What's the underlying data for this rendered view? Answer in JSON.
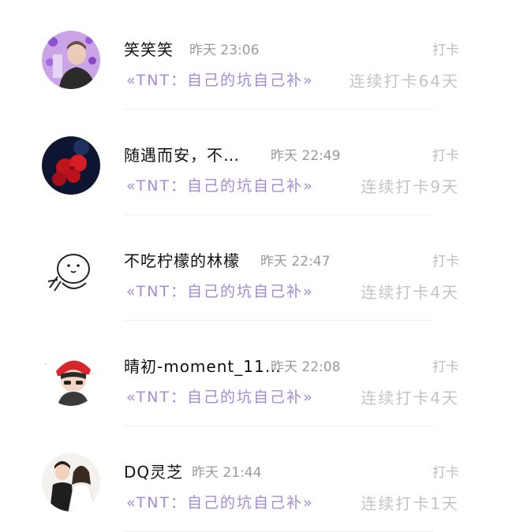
{
  "colors": {
    "group_link": "#a58ad6",
    "time": "#9a9a9a",
    "action": "#bdbdbd",
    "streak": "#c4c4c4"
  },
  "records": [
    {
      "avatar": "avatar-purple-hearts-photo",
      "name": "笑笑笑",
      "time": "昨天 23:06",
      "action": "打卡",
      "group": "«TNT：自己的坑自己补»",
      "streak": "连续打卡64天"
    },
    {
      "avatar": "avatar-red-roses-photo",
      "name": "随遇而安，不…",
      "time": "昨天 22:49",
      "action": "打卡",
      "group": "«TNT：自己的坑自己补»",
      "streak": "连续打卡9天"
    },
    {
      "avatar": "avatar-cartoon-doodle",
      "name": "不吃柠檬的林檬",
      "time": "昨天 22:47",
      "action": "打卡",
      "group": "«TNT：自己的坑自己补»",
      "streak": "连续打卡4天"
    },
    {
      "avatar": "avatar-anime-boy-red-cap",
      "name": "晴初-moment_11…",
      "time": "昨天 22:08",
      "action": "打卡",
      "group": "«TNT：自己的坑自己补»",
      "streak": "连续打卡4天"
    },
    {
      "avatar": "avatar-couple-photo",
      "name": "DQ灵芝",
      "time": "昨天 21:44",
      "action": "打卡",
      "group": "«TNT：自己的坑自己补»",
      "streak": "连续打卡1天"
    }
  ]
}
